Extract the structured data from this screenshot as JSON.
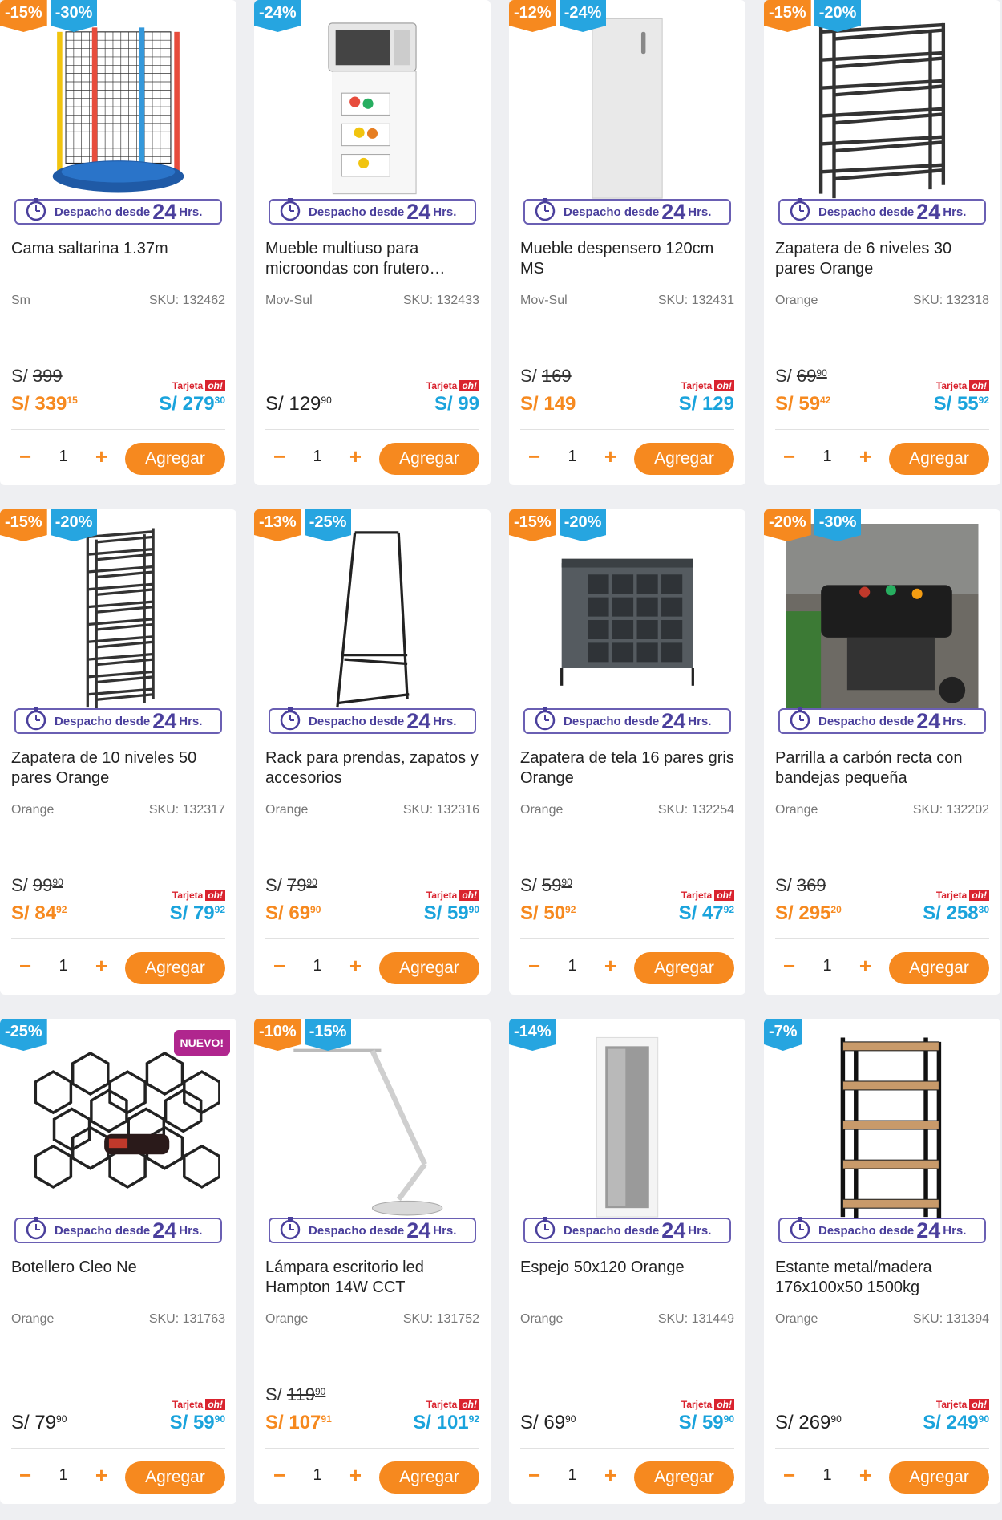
{
  "products": [
    {
      "discounts": [
        "-15%",
        "-30%"
      ],
      "nuevo": "",
      "despacho": "Despacho desde",
      "hours": "24",
      "hrs": "Hrs.",
      "name": "Cama saltarina 1.37m",
      "brand": "Sm",
      "sku": "SKU: 132462",
      "old_prefix": "S/",
      "old_main": "399",
      "old_cents": "",
      "price_main": "S/ 339",
      "price_cents": "15",
      "price_style": "orange",
      "tarjeta": "Tarjeta",
      "oh": "oh!",
      "oh_main": "S/ 279",
      "oh_cents": "30",
      "qty": "1",
      "add": "Agregar",
      "img": "trampoline"
    },
    {
      "discounts": [
        "-24%"
      ],
      "nuevo": "",
      "despacho": "Despacho desde",
      "hours": "24",
      "hrs": "Hrs.",
      "name": "Mueble multiuso para microondas con frutero…",
      "brand": "Mov-Sul",
      "sku": "SKU: 132433",
      "old_prefix": "",
      "old_main": "",
      "old_cents": "",
      "price_main": "S/ 129",
      "price_cents": "90",
      "price_style": "dark",
      "tarjeta": "Tarjeta",
      "oh": "oh!",
      "oh_main": "S/ 99",
      "oh_cents": "",
      "qty": "1",
      "add": "Agregar",
      "img": "microwave"
    },
    {
      "discounts": [
        "-12%",
        "-24%"
      ],
      "nuevo": "",
      "despacho": "Despacho desde",
      "hours": "24",
      "hrs": "Hrs.",
      "name": "Mueble despensero 120cm MS",
      "brand": "Mov-Sul",
      "sku": "SKU: 132431",
      "old_prefix": "S/",
      "old_main": "169",
      "old_cents": "",
      "price_main": "S/ 149",
      "price_cents": "",
      "price_style": "orange",
      "tarjeta": "Tarjeta",
      "oh": "oh!",
      "oh_main": "S/ 129",
      "oh_cents": "",
      "qty": "1",
      "add": "Agregar",
      "img": "cabinet"
    },
    {
      "discounts": [
        "-15%",
        "-20%"
      ],
      "nuevo": "",
      "despacho": "Despacho desde",
      "hours": "24",
      "hrs": "Hrs.",
      "name": "Zapatera de 6 niveles 30 pares Orange",
      "brand": "Orange",
      "sku": "SKU: 132318",
      "old_prefix": "S/",
      "old_main": "69",
      "old_cents": "90",
      "price_main": "S/ 59",
      "price_cents": "42",
      "price_style": "orange",
      "tarjeta": "Tarjeta",
      "oh": "oh!",
      "oh_main": "S/ 55",
      "oh_cents": "92",
      "qty": "1",
      "add": "Agregar",
      "img": "shoerack6"
    },
    {
      "discounts": [
        "-15%",
        "-20%"
      ],
      "nuevo": "",
      "despacho": "Despacho desde",
      "hours": "24",
      "hrs": "Hrs.",
      "name": "Zapatera de 10 niveles 50 pares Orange",
      "brand": "Orange",
      "sku": "SKU: 132317",
      "old_prefix": "S/",
      "old_main": "99",
      "old_cents": "90",
      "price_main": "S/ 84",
      "price_cents": "92",
      "price_style": "orange",
      "tarjeta": "Tarjeta",
      "oh": "oh!",
      "oh_main": "S/ 79",
      "oh_cents": "92",
      "qty": "1",
      "add": "Agregar",
      "img": "shoerack10"
    },
    {
      "discounts": [
        "-13%",
        "-25%"
      ],
      "nuevo": "",
      "despacho": "Despacho desde",
      "hours": "24",
      "hrs": "Hrs.",
      "name": "Rack para prendas, zapatos y accesorios",
      "brand": "Orange",
      "sku": "SKU: 132316",
      "old_prefix": "S/",
      "old_main": "79",
      "old_cents": "90",
      "price_main": "S/ 69",
      "price_cents": "90",
      "price_style": "orange",
      "tarjeta": "Tarjeta",
      "oh": "oh!",
      "oh_main": "S/ 59",
      "oh_cents": "90",
      "qty": "1",
      "add": "Agregar",
      "img": "clothesrack"
    },
    {
      "discounts": [
        "-15%",
        "-20%"
      ],
      "nuevo": "",
      "despacho": "Despacho desde",
      "hours": "24",
      "hrs": "Hrs.",
      "name": "Zapatera de tela 16 pares gris Orange",
      "brand": "Orange",
      "sku": "SKU: 132254",
      "old_prefix": "S/",
      "old_main": "59",
      "old_cents": "90",
      "price_main": "S/ 50",
      "price_cents": "92",
      "price_style": "orange",
      "tarjeta": "Tarjeta",
      "oh": "oh!",
      "oh_main": "S/ 47",
      "oh_cents": "92",
      "qty": "1",
      "add": "Agregar",
      "img": "fabricrack"
    },
    {
      "discounts": [
        "-20%",
        "-30%"
      ],
      "nuevo": "",
      "despacho": "Despacho desde",
      "hours": "24",
      "hrs": "Hrs.",
      "name": "Parrilla a carbón recta con bandejas pequeña",
      "brand": "Orange",
      "sku": "SKU: 132202",
      "old_prefix": "S/",
      "old_main": "369",
      "old_cents": "",
      "price_main": "S/ 295",
      "price_cents": "20",
      "price_style": "orange",
      "tarjeta": "Tarjeta",
      "oh": "oh!",
      "oh_main": "S/ 258",
      "oh_cents": "30",
      "qty": "1",
      "add": "Agregar",
      "img": "grill"
    },
    {
      "discounts": [
        "-25%"
      ],
      "nuevo": "NUEVO!",
      "despacho": "Despacho desde",
      "hours": "24",
      "hrs": "Hrs.",
      "name": "Botellero Cleo Ne",
      "brand": "Orange",
      "sku": "SKU: 131763",
      "old_prefix": "",
      "old_main": "",
      "old_cents": "",
      "price_main": "S/ 79",
      "price_cents": "90",
      "price_style": "dark",
      "tarjeta": "Tarjeta",
      "oh": "oh!",
      "oh_main": "S/ 59",
      "oh_cents": "90",
      "qty": "1",
      "add": "Agregar",
      "img": "winerack"
    },
    {
      "discounts": [
        "-10%",
        "-15%"
      ],
      "nuevo": "",
      "despacho": "Despacho desde",
      "hours": "24",
      "hrs": "Hrs.",
      "name": "Lámpara escritorio led Hampton 14W CCT",
      "brand": "Orange",
      "sku": "SKU: 131752",
      "old_prefix": "S/",
      "old_main": "119",
      "old_cents": "90",
      "price_main": "S/ 107",
      "price_cents": "91",
      "price_style": "orange",
      "tarjeta": "Tarjeta",
      "oh": "oh!",
      "oh_main": "S/ 101",
      "oh_cents": "92",
      "qty": "1",
      "add": "Agregar",
      "img": "lamp"
    },
    {
      "discounts": [
        "-14%"
      ],
      "nuevo": "",
      "despacho": "Despacho desde",
      "hours": "24",
      "hrs": "Hrs.",
      "name": "Espejo 50x120 Orange",
      "brand": "Orange",
      "sku": "SKU: 131449",
      "old_prefix": "",
      "old_main": "",
      "old_cents": "",
      "price_main": "S/ 69",
      "price_cents": "90",
      "price_style": "dark",
      "tarjeta": "Tarjeta",
      "oh": "oh!",
      "oh_main": "S/ 59",
      "oh_cents": "90",
      "qty": "1",
      "add": "Agregar",
      "img": "mirror"
    },
    {
      "discounts": [
        "-7%"
      ],
      "nuevo": "",
      "despacho": "Despacho desde",
      "hours": "24",
      "hrs": "Hrs.",
      "name": "Estante metal/madera 176x100x50 1500kg",
      "brand": "Orange",
      "sku": "SKU: 131394",
      "old_prefix": "",
      "old_main": "",
      "old_cents": "",
      "price_main": "S/ 269",
      "price_cents": "90",
      "price_style": "dark",
      "tarjeta": "Tarjeta",
      "oh": "oh!",
      "oh_main": "S/ 249",
      "oh_cents": "90",
      "qty": "1",
      "add": "Agregar",
      "img": "shelf"
    }
  ],
  "colors": {
    "accent": "#f6891f",
    "oh_blue": "#1aa3dc",
    "badge_blue": "#26a5e0",
    "despacho_purple": "#4a3f9c",
    "nuevo": "#b0268e"
  }
}
